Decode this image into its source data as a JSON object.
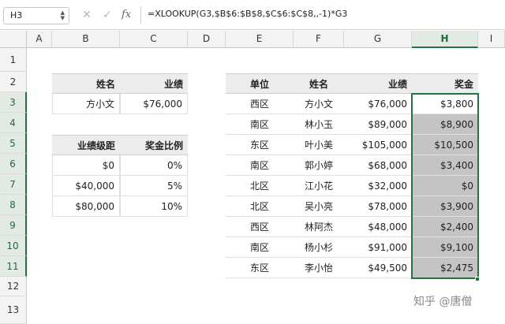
{
  "formula_bar": {
    "name_box": "H3",
    "cancel_icon": "✕",
    "enter_icon": "✓",
    "fx_label": "fx",
    "formula": "=XLOOKUP(G3,$B$6:$B$8,$C$6:$C$8,,-1)*G3"
  },
  "columns": [
    "A",
    "B",
    "C",
    "D",
    "E",
    "F",
    "G",
    "H",
    "I"
  ],
  "rows": [
    "1",
    "2",
    "3",
    "4",
    "5",
    "6",
    "7",
    "8",
    "9",
    "10",
    "11",
    "12",
    "13"
  ],
  "lookup_table": {
    "headers": [
      "姓名",
      "业绩"
    ],
    "row": [
      "方小文",
      "$76,000"
    ]
  },
  "rate_table": {
    "headers": [
      "业绩级距",
      "奖金比例"
    ],
    "rows": [
      [
        "$0",
        "0%"
      ],
      [
        "$40,000",
        "5%"
      ],
      [
        "$80,000",
        "10%"
      ]
    ]
  },
  "main_table": {
    "headers": [
      "单位",
      "姓名",
      "业绩",
      "奖金"
    ],
    "rows": [
      [
        "西区",
        "方小文",
        "$76,000",
        "$3,800"
      ],
      [
        "南区",
        "林小玉",
        "$89,000",
        "$8,900"
      ],
      [
        "东区",
        "叶小美",
        "$105,000",
        "$10,500"
      ],
      [
        "南区",
        "郭小婷",
        "$68,000",
        "$3,400"
      ],
      [
        "北区",
        "江小花",
        "$32,000",
        "$0"
      ],
      [
        "北区",
        "吴小亮",
        "$78,000",
        "$3,900"
      ],
      [
        "西区",
        "林阿杰",
        "$48,000",
        "$2,400"
      ],
      [
        "南区",
        "杨小杉",
        "$91,000",
        "$9,100"
      ],
      [
        "东区",
        "李小怡",
        "$49,500",
        "$2,475"
      ]
    ]
  },
  "watermark": "知乎 @唐僧"
}
